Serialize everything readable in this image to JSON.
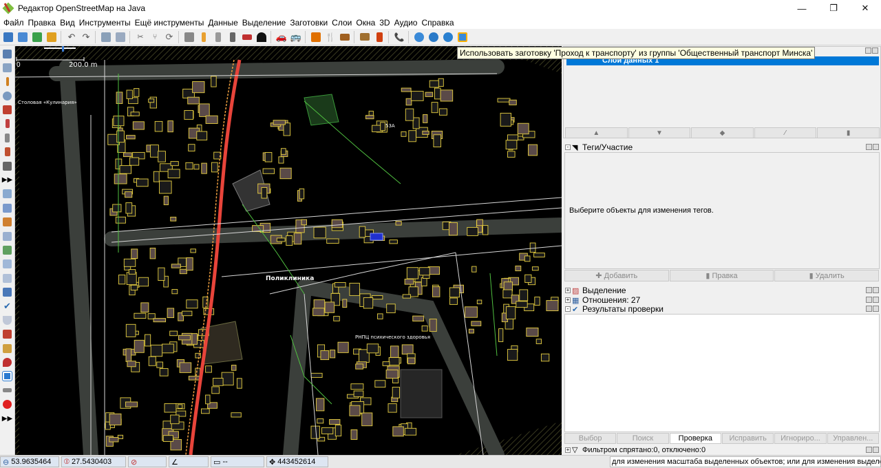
{
  "window": {
    "title": "Редактор OpenStreetMap на Java",
    "minimize": "—",
    "maximize": "❐",
    "close": "✕"
  },
  "menu": [
    "Файл",
    "Правка",
    "Вид",
    "Инструменты",
    "Ещё инструменты",
    "Данные",
    "Выделение",
    "Заготовки",
    "Слои",
    "Окна",
    "3D",
    "Аудио",
    "Справка"
  ],
  "tooltip": "Использовать заготовку 'Проход к транспорту' из группы 'Общественный транспорт Минска'",
  "map": {
    "scale_zero": "0",
    "scale_label": "200.0 m",
    "labels": {
      "poliklinika": "Поликлиника",
      "rnpc": "РНПЦ психического здоровья",
      "sign1": "Столовая «Кулинария»",
      "building_53a": "53А"
    }
  },
  "layers": {
    "layer_name": "Слой данных 1"
  },
  "panels": {
    "tags_title": "Теги/Участие",
    "tags_empty": "Выберите объекты для изменения тегов.",
    "add": "Добавить",
    "edit": "Правка",
    "delete": "Удалить",
    "selection": "Выделение",
    "relations": "Отношения: 27",
    "validation": "Результаты проверки",
    "tabs": [
      "Выбор",
      "Поиск",
      "Проверка",
      "Исправить",
      "Игнориро...",
      "Управлен..."
    ],
    "filter": "Фильтром спрятано:0, отключено:0"
  },
  "status": {
    "lat": "53.9635464",
    "lon": "27.5430403",
    "heading": "",
    "angle": "",
    "length": "--",
    "id": "443452614",
    "help": "для изменения масштаба выделенных объектов; или для изменения выделения"
  }
}
